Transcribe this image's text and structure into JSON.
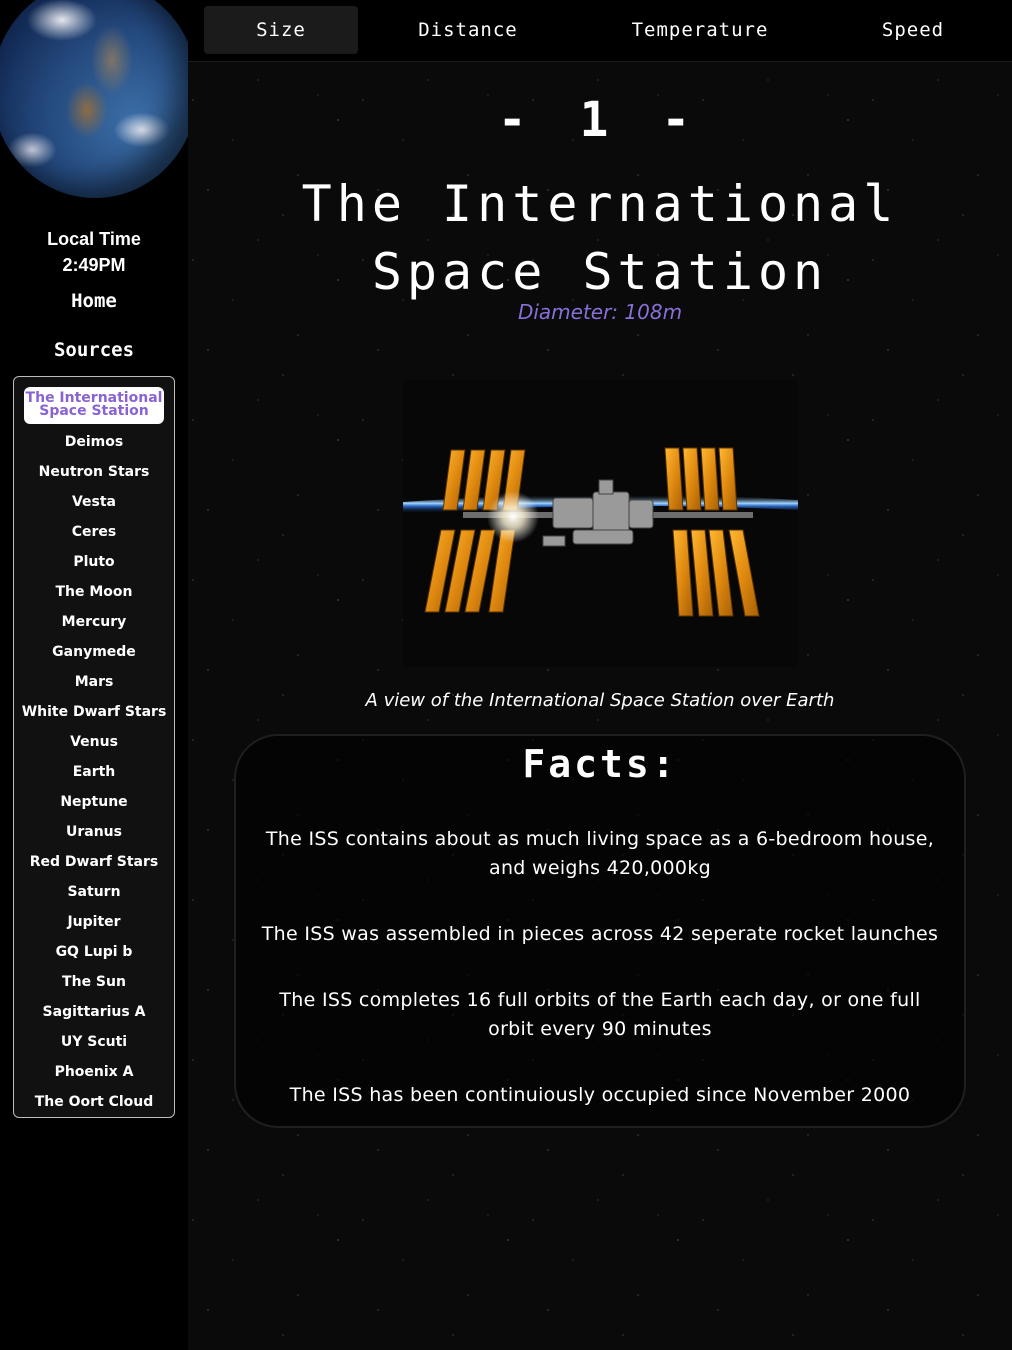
{
  "sidebar": {
    "local_time_label": "Local Time",
    "local_time_value": "2:49PM",
    "home_label": "Home",
    "sources_label": "Sources",
    "items": [
      {
        "label": "The International Space Station",
        "active": true
      },
      {
        "label": "Deimos"
      },
      {
        "label": "Neutron Stars"
      },
      {
        "label": "Vesta"
      },
      {
        "label": "Ceres"
      },
      {
        "label": "Pluto"
      },
      {
        "label": "The Moon"
      },
      {
        "label": "Mercury"
      },
      {
        "label": "Ganymede"
      },
      {
        "label": "Mars"
      },
      {
        "label": "White Dwarf Stars"
      },
      {
        "label": "Venus"
      },
      {
        "label": "Earth"
      },
      {
        "label": "Neptune"
      },
      {
        "label": "Uranus"
      },
      {
        "label": "Red Dwarf Stars"
      },
      {
        "label": "Saturn"
      },
      {
        "label": "Jupiter"
      },
      {
        "label": "GQ Lupi b"
      },
      {
        "label": "The Sun"
      },
      {
        "label": "Sagittarius A"
      },
      {
        "label": "UY Scuti"
      },
      {
        "label": "Phoenix A"
      },
      {
        "label": "The Oort Cloud"
      }
    ]
  },
  "tabs": [
    {
      "label": "Size",
      "active": true
    },
    {
      "label": "Distance"
    },
    {
      "label": "Temperature"
    },
    {
      "label": "Speed"
    }
  ],
  "main": {
    "rank": "- 1 -",
    "title": "The International Space Station",
    "diameter": "Diameter: 108m",
    "caption": "A view of the International Space Station over Earth",
    "facts_title": "Facts:",
    "facts": [
      "The ISS contains about as much living space as a 6-bedroom house, and weighs 420,000kg",
      "The ISS was assembled in pieces across 42 seperate rocket launches",
      "The ISS completes 16 full orbits of the Earth each day, or one full orbit every 90 minutes",
      "The ISS has been continuiously occupied since November 2000"
    ]
  },
  "colors": {
    "accent": "#8a6fd8",
    "background": "#000000",
    "text": "#ffffff"
  }
}
